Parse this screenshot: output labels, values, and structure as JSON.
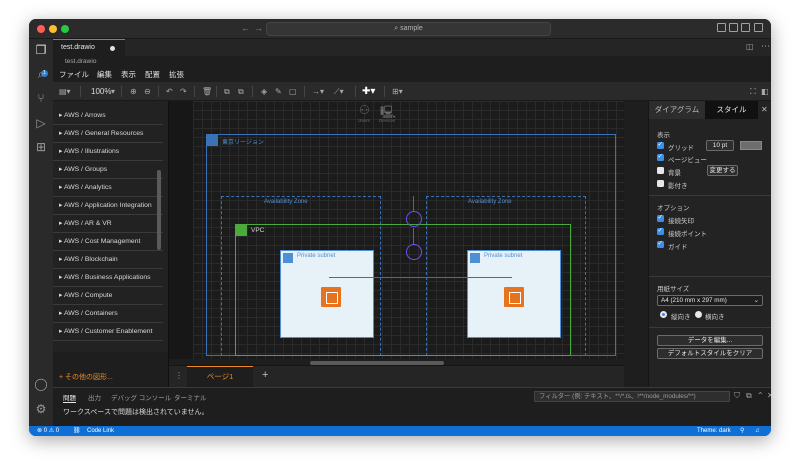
{
  "titlebar": {
    "search_text": "⌕ sample",
    "back_arrow": "←",
    "forward_arrow": "→"
  },
  "activity": {
    "badge": "1"
  },
  "editor": {
    "tab_label": "test.drawio",
    "breadcrumb": "test.drawio"
  },
  "menu": [
    "ファイル",
    "編集",
    "表示",
    "配置",
    "拡張"
  ],
  "toolbar": {
    "zoom": "100%"
  },
  "shapes": {
    "items": [
      "AWS / Arrows",
      "AWS / General Resources",
      "AWS / Illustrations",
      "AWS / Groups",
      "AWS / Analytics",
      "AWS / Application Integration",
      "AWS / AR & VR",
      "AWS / Cost Management",
      "AWS / Blockchain",
      "AWS / Business Applications",
      "AWS / Compute",
      "AWS / Containers",
      "AWS / Customer Enablement"
    ],
    "more": "+ その他の図形..."
  },
  "diagram": {
    "region": "東京リージョン",
    "az_left": "Availability Zone",
    "az_right": "Availability Zone",
    "vpc": "VPC",
    "subnet_left": "Private subnet",
    "subnet_right": "Private subnet",
    "users": "Users",
    "devices": "Devices"
  },
  "pages": {
    "current": "ページ1",
    "add": "+"
  },
  "format_panel": {
    "tab_diagram": "ダイアグラム",
    "tab_style": "スタイル",
    "view_title": "表示",
    "grid": "グリッド",
    "grid_size": "10 pt",
    "page_view": "ページビュー",
    "background": "背景",
    "shadow": "影付き",
    "change_button": "変更する",
    "options_title": "オプション",
    "connection_arrows": "接続矢印",
    "connection_points": "接続ポイント",
    "guides": "ガイド",
    "paper_size_title": "用紙サイズ",
    "paper_size": "A4 (210 mm x 297 mm)",
    "portrait": "縦向き",
    "landscape": "横向き",
    "edit_data_button": "データを編集...",
    "clear_default_style_button": "デフォルトスタイルをクリア"
  },
  "panel": {
    "tabs": [
      "問題",
      "出力",
      "デバッグ コンソール",
      "ターミナル"
    ],
    "filter_placeholder": "フィルター (例: テキスト、**/*.ts、!**/node_modules/**)",
    "message": "ワークスペースで問題は検出されていません。"
  },
  "status": {
    "problems": "⊗ 0 ⚠ 0",
    "code_link": "Code Link",
    "theme": "Theme: dark"
  },
  "colors": {
    "accent": "#3b8eea",
    "drawio_orange": "#f08a24",
    "status_bar": "#0e6fd6",
    "aws_region_blue": "#3a72b8",
    "vpc_green": "#4caa3c",
    "ec2_orange": "#e8731e",
    "vpc_endpoint_purple": "#6f4ff5"
  }
}
